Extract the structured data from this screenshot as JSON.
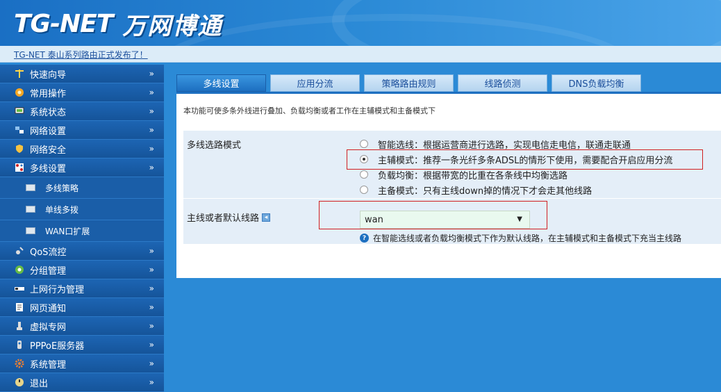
{
  "header": {
    "brand": "TG-NET",
    "brand_cn": "万网博通"
  },
  "notice": {
    "text": "TG-NET 泰山系列路由正式发布了！"
  },
  "sidebar": {
    "items": [
      {
        "label": "快速向导",
        "icon": "wand-icon",
        "arrow": "»"
      },
      {
        "label": "常用操作",
        "icon": "star-icon",
        "arrow": "»"
      },
      {
        "label": "系统状态",
        "icon": "monitor-icon",
        "arrow": "»"
      },
      {
        "label": "网络设置",
        "icon": "network-icon",
        "arrow": "»"
      },
      {
        "label": "网络安全",
        "icon": "shield-icon",
        "arrow": "»"
      },
      {
        "label": "多线设置",
        "icon": "multiline-icon",
        "arrow": "»"
      }
    ],
    "sub_items": [
      {
        "label": "多线策略"
      },
      {
        "label": "单线多拨"
      },
      {
        "label": "WAN口扩展"
      }
    ],
    "items_after": [
      {
        "label": "QoS流控",
        "icon": "qos-icon",
        "arrow": "»"
      },
      {
        "label": "分组管理",
        "icon": "group-icon",
        "arrow": "»"
      },
      {
        "label": "上网行为管理",
        "icon": "behavior-icon",
        "arrow": "»"
      },
      {
        "label": "网页通知",
        "icon": "notice-icon",
        "arrow": "»"
      },
      {
        "label": "虚拟专网",
        "icon": "vpn-icon",
        "arrow": "»"
      },
      {
        "label": "PPPoE服务器",
        "icon": "pppoe-icon",
        "arrow": "»"
      },
      {
        "label": "系统管理",
        "icon": "gear-icon",
        "arrow": "»"
      },
      {
        "label": "退出",
        "icon": "exit-icon",
        "arrow": "»"
      }
    ]
  },
  "tabs": [
    "多线设置",
    "应用分流",
    "策略路由规则",
    "线路侦测",
    "DNS负载均衡"
  ],
  "main": {
    "description": "本功能可使多条外线进行叠加、负载均衡或者工作在主辅模式和主备模式下",
    "mode": {
      "label": "多线选路模式",
      "options": [
        {
          "text": "智能选线：根据运营商进行选路，实现电信走电信，联通走联通",
          "checked": false
        },
        {
          "text": "主辅模式：推荐一条光纤多条ADSL的情形下使用，需要配合开启应用分流",
          "checked": true
        },
        {
          "text": "负载均衡：根据带宽的比重在各条线中均衡选路",
          "checked": false
        },
        {
          "text": "主备模式：只有主线down掉的情况下才会走其他线路",
          "checked": false
        }
      ]
    },
    "line": {
      "label": "主线或者默认线路",
      "value": "wan",
      "hint": "在智能选线或者负载均衡模式下作为默认线路，在主辅模式和主备模式下充当主线路"
    }
  },
  "colors": {
    "accent": "#1d6fc0",
    "highlight_box": "#d02020"
  }
}
